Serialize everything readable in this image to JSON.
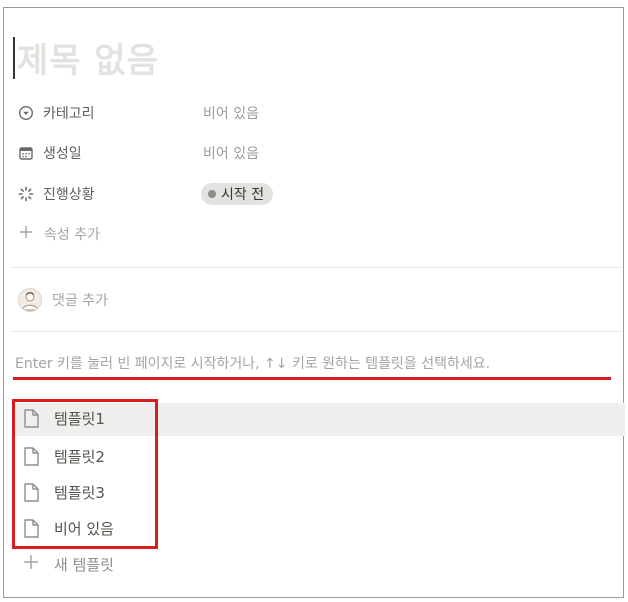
{
  "page": {
    "title_placeholder": "제목 없음"
  },
  "properties": [
    {
      "icon": "chevron-circle-icon",
      "name": "카테고리",
      "value": "비어 있음"
    },
    {
      "icon": "calendar-icon",
      "name": "생성일",
      "value": "비어 있음"
    },
    {
      "icon": "loader-icon",
      "name": "진행상황",
      "status": "시작 전"
    }
  ],
  "add_property_label": "속성 추가",
  "comment": {
    "label": "댓글 추가"
  },
  "hint_text": "Enter 키를 눌러 빈 페이지로 시작하거나, ↑↓ 키로 원하는 템플릿을 선택하세요.",
  "templates": [
    {
      "label": "템플릿1",
      "selected": true
    },
    {
      "label": "템플릿2",
      "selected": false
    },
    {
      "label": "템플릿3",
      "selected": false
    },
    {
      "label": "비어 있음",
      "selected": false
    }
  ],
  "new_template_label": "새 템플릿",
  "colors": {
    "annotation_red": "#d81e1e",
    "placeholder": "#e3e2df",
    "status_pill": "#e3e2e0"
  }
}
